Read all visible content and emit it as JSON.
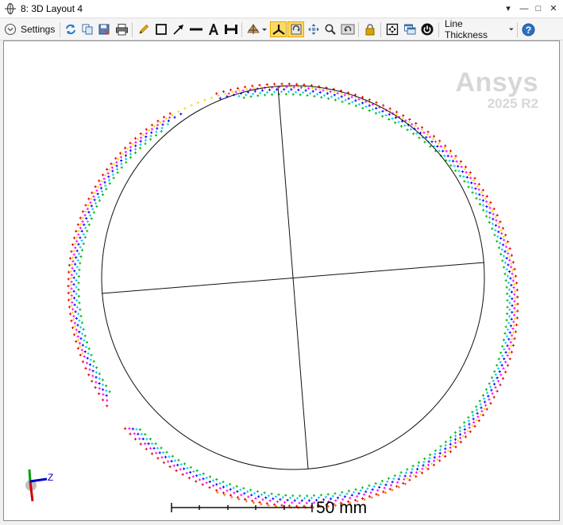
{
  "window": {
    "title": "8: 3D Layout 4"
  },
  "title_controls": {
    "dropdown": "▾",
    "minimize": "—",
    "maximize": "□",
    "close": "✕"
  },
  "toolbar": {
    "settings_label": "Settings",
    "line_thickness_label": "Line Thickness",
    "tools": [
      "refresh-icon",
      "copy-icon",
      "save-icon",
      "print-icon",
      "pencil-icon",
      "rectangle-icon",
      "arrow-icon",
      "line-icon",
      "text-icon",
      "dimension-icon",
      "rotate-view-icon",
      "axes-view-icon",
      "rotate-mode-icon",
      "pan-icon",
      "zoom-icon",
      "reset-view-icon",
      "lock-icon",
      "fit-icon",
      "window-icon",
      "power-icon",
      "help-icon"
    ]
  },
  "viewport": {
    "watermark_brand": "Ansys",
    "watermark_version": "2025 R2",
    "axis_label": "Z",
    "scale_label": "50 mm",
    "ray_colors": [
      "#e00000",
      "#ff00ff",
      "#0000ff",
      "#00c8ff",
      "#00b400",
      "#ffd400",
      "#ff6600"
    ]
  }
}
